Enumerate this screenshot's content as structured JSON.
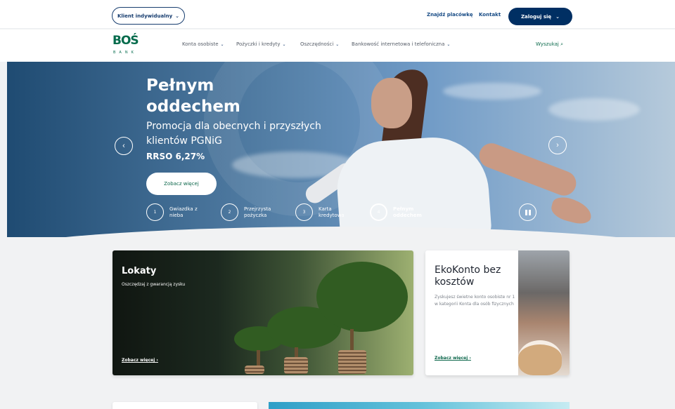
{
  "topbar": {
    "client_label": "Klient indywidualny",
    "find_branch": "Znajdź placówkę",
    "contact": "Kontakt",
    "login": "Zaloguj się"
  },
  "logo": {
    "main": "BOŚ",
    "sub": "BANK"
  },
  "nav": {
    "items": [
      "Konta osobiste",
      "Pożyczki i kredyty",
      "Oszczędności",
      "Bankowość internetowa i telefoniczna"
    ],
    "search": "Wyszukaj"
  },
  "hero": {
    "title": "Pełnym oddechem",
    "subtitle": "Promocja dla obecnych i przyszłych klientów PGNiG",
    "rrso": "RRSO 6,27%",
    "cta": "Zobacz więcej",
    "slides": [
      {
        "number": "1",
        "label": "Gwiazdka z nieba"
      },
      {
        "number": "2",
        "label": "Przejrzysta pożyczka"
      },
      {
        "number": "3",
        "label": "Karta kredytowa"
      },
      {
        "number": "4",
        "label": "Pełnym oddechem"
      }
    ]
  },
  "cards": {
    "lokaty": {
      "title": "Lokaty",
      "subtitle": "Oszczędzaj z gwarancją zysku",
      "link": "Zobacz więcej"
    },
    "ekokonto": {
      "title": "EkoKonto bez kosztów",
      "text": "Zyskujesz świetne konto osobiste nr 1 w kategorii Konta dla osób fizycznych",
      "link": "Zobacz więcej"
    }
  },
  "icons": {
    "caret": "chevron-down-icon",
    "search": "search-icon",
    "left_arrow": "chevron-left-icon",
    "right_arrow": "chevron-right-icon",
    "pause": "pause-icon"
  },
  "colors": {
    "brand_green": "#0b664a",
    "brand_navy": "#002f63"
  }
}
